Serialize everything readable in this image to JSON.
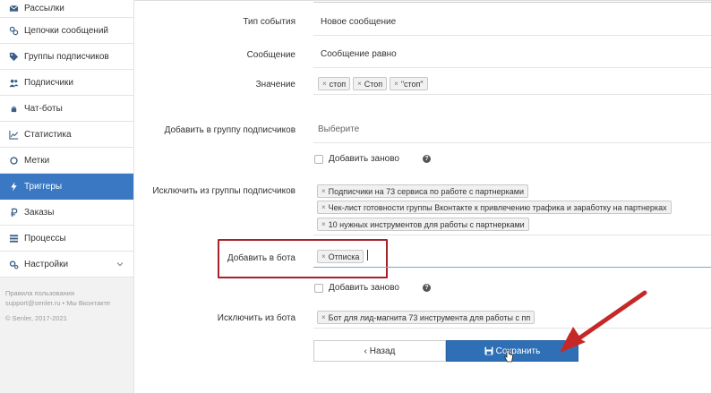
{
  "sidebar": {
    "items": [
      {
        "label": "Рассылки",
        "icon": "envelope-icon"
      },
      {
        "label": "Цепочки сообщений",
        "icon": "chain-icon"
      },
      {
        "label": "Группы подписчиков",
        "icon": "tag-icon"
      },
      {
        "label": "Подписчики",
        "icon": "users-icon"
      },
      {
        "label": "Чат-боты",
        "icon": "android-icon"
      },
      {
        "label": "Статистика",
        "icon": "chart-icon"
      },
      {
        "label": "Метки",
        "icon": "circle-icon"
      },
      {
        "label": "Триггеры",
        "icon": "bolt-icon",
        "active": true
      },
      {
        "label": "Заказы",
        "icon": "ruble-icon"
      },
      {
        "label": "Процессы",
        "icon": "list-icon"
      },
      {
        "label": "Настройки",
        "icon": "gear-icon",
        "has_chevron": true
      }
    ],
    "footer": {
      "terms": "Правила пользования",
      "support": "support@senler.ru • Мы Вконтакте",
      "copyright": "© Senler, 2017-2021"
    }
  },
  "form": {
    "event_type_label": "Тип события",
    "event_type_value": "Новое сообщение",
    "message_label": "Сообщение",
    "message_value": "Сообщение равно",
    "value_label": "Значение",
    "value_chips": [
      "стоп",
      "Стоп",
      "\"стоп\""
    ],
    "add_group_label": "Добавить в группу подписчиков",
    "add_group_placeholder": "Выберите",
    "add_again_label": "Добавить заново",
    "exclude_group_label": "Исключить из группы подписчиков",
    "exclude_group_chips": [
      "Подписчики на 73 сервиса по работе с партнерками",
      "Чек-лист готовности группы Вконтакте к привлечению трафика и заработку на партнерках",
      "10 нужных инструментов для работы с партнерками"
    ],
    "add_bot_label": "Добавить в бота",
    "add_bot_chips": [
      "Отписка"
    ],
    "add_again_label_2": "Добавить заново",
    "exclude_bot_label": "Исключить из бота",
    "exclude_bot_chips": [
      "Бот для лид-магнита 73 инструмента для работы с пп"
    ]
  },
  "buttons": {
    "back": "‹ Назад",
    "save": "Сохранить"
  },
  "colors": {
    "accent": "#3a78c3",
    "save_button": "#2f6fb5",
    "highlight_box": "#a8222a",
    "arrow": "#c62828"
  }
}
